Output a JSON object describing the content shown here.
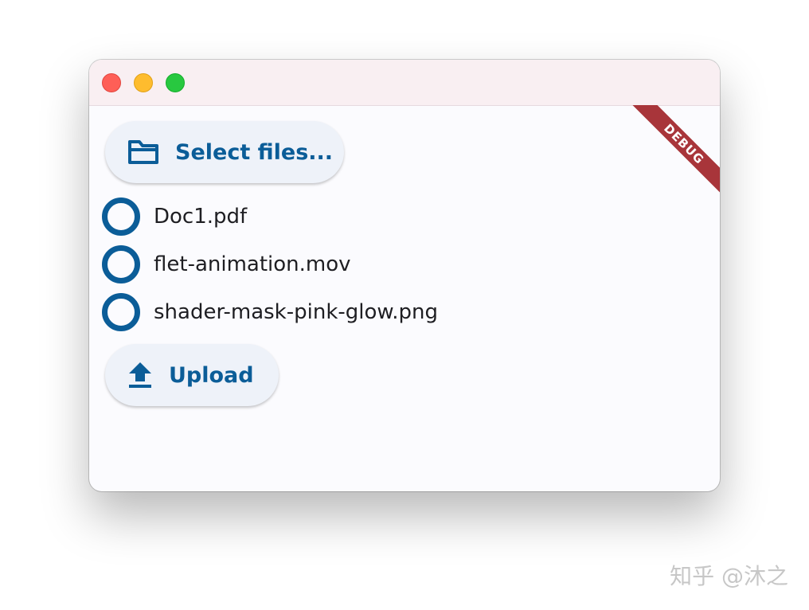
{
  "window": {
    "traffic_lights": [
      "close",
      "minimize",
      "maximize"
    ]
  },
  "select_button": {
    "label": "Select files...",
    "icon": "folder-icon"
  },
  "files": [
    {
      "name": "Doc1.pdf",
      "status": "pending"
    },
    {
      "name": "flet-animation.mov",
      "status": "pending"
    },
    {
      "name": "shader-mask-pink-glow.png",
      "status": "pending"
    }
  ],
  "upload_button": {
    "label": "Upload",
    "icon": "upload-icon"
  },
  "debug_banner": "DEBUG",
  "watermark": "知乎 @沐之",
  "colors": {
    "accent": "#0b5d98",
    "button_bg": "#eef2f9",
    "titlebar_bg": "#f9eff2",
    "debug_ribbon": "#a8353a"
  }
}
